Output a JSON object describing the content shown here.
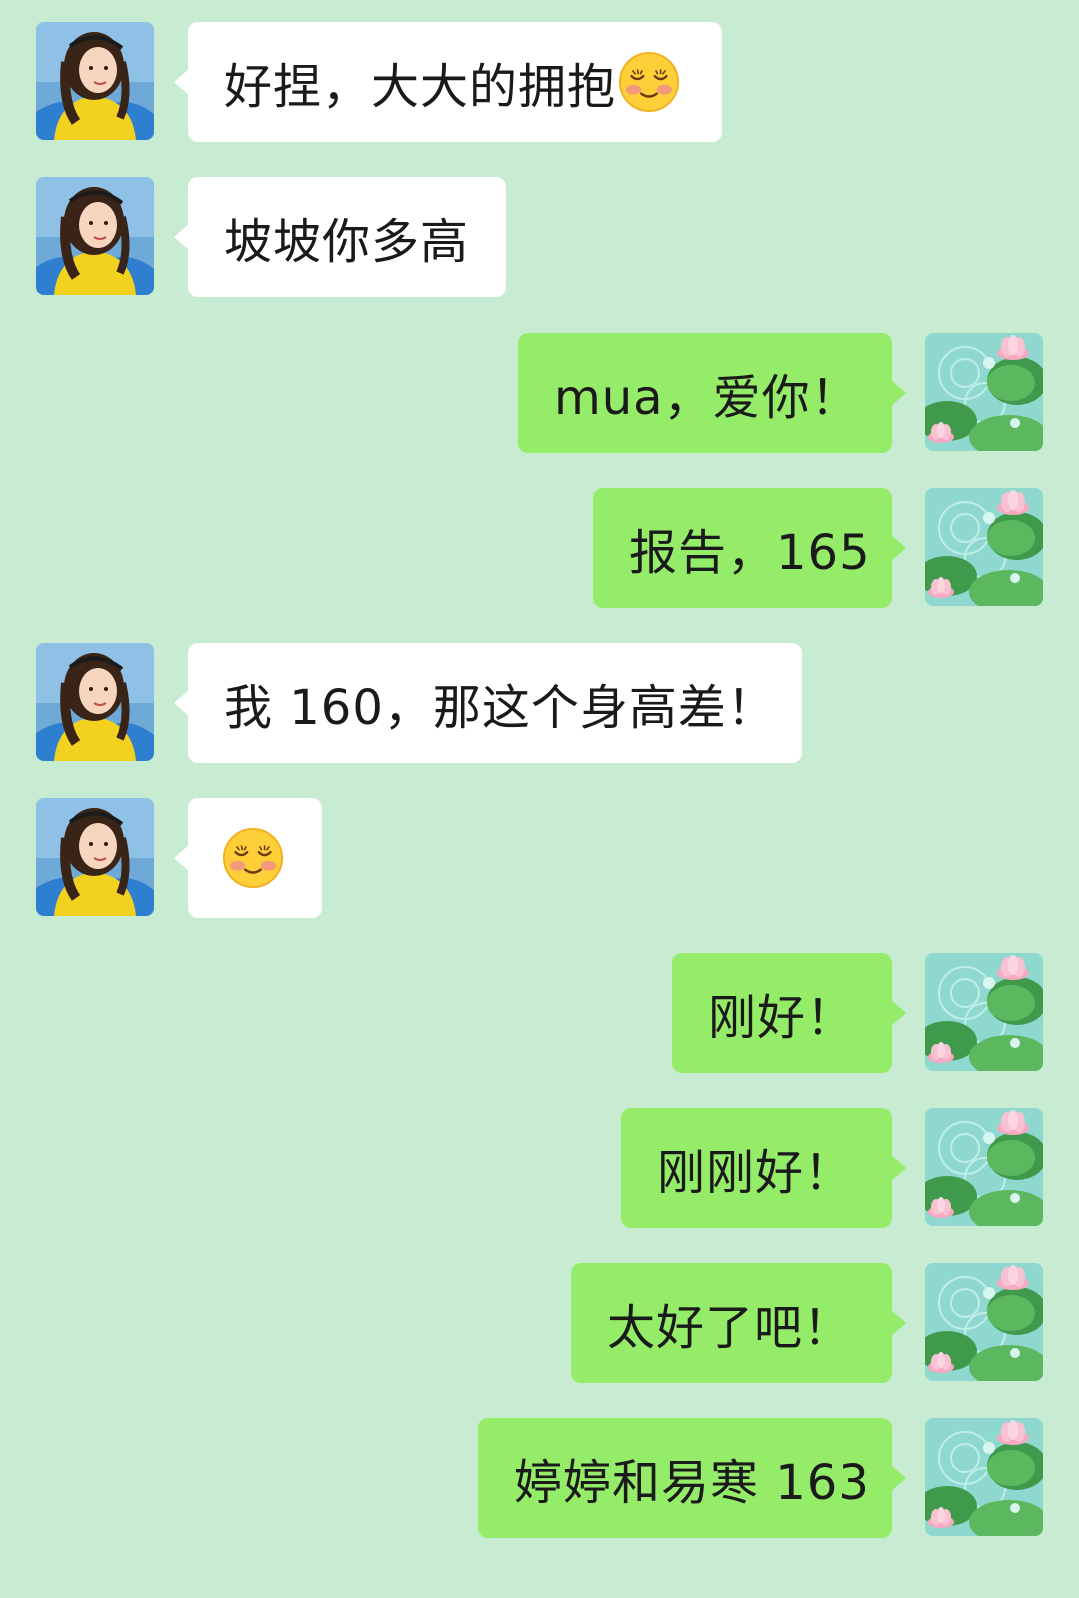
{
  "chat": {
    "background": "#c8ecd1",
    "incoming_bubble_color": "#ffffff",
    "outgoing_bubble_color": "#95ec69",
    "messages": [
      {
        "side": "left",
        "text": "好捏，大大的拥抱",
        "emoji": "shy-smile"
      },
      {
        "side": "left",
        "text": "坡坡你多高"
      },
      {
        "side": "right",
        "text": "mua，爱你！"
      },
      {
        "side": "right",
        "text": "报告，165"
      },
      {
        "side": "left",
        "text": "我 160，那这个身高差！"
      },
      {
        "side": "left",
        "text": "",
        "emoji": "shy-smile"
      },
      {
        "side": "right",
        "text": "刚好！"
      },
      {
        "side": "right",
        "text": "刚刚好！"
      },
      {
        "side": "right",
        "text": "太好了吧！"
      },
      {
        "side": "right",
        "text": "婷婷和易寒 163"
      }
    ]
  },
  "icons": {
    "incoming_avatar": "girl-portrait-avatar",
    "outgoing_avatar": "lotus-pond-avatar",
    "emoji": "shy-smile-emoji"
  }
}
